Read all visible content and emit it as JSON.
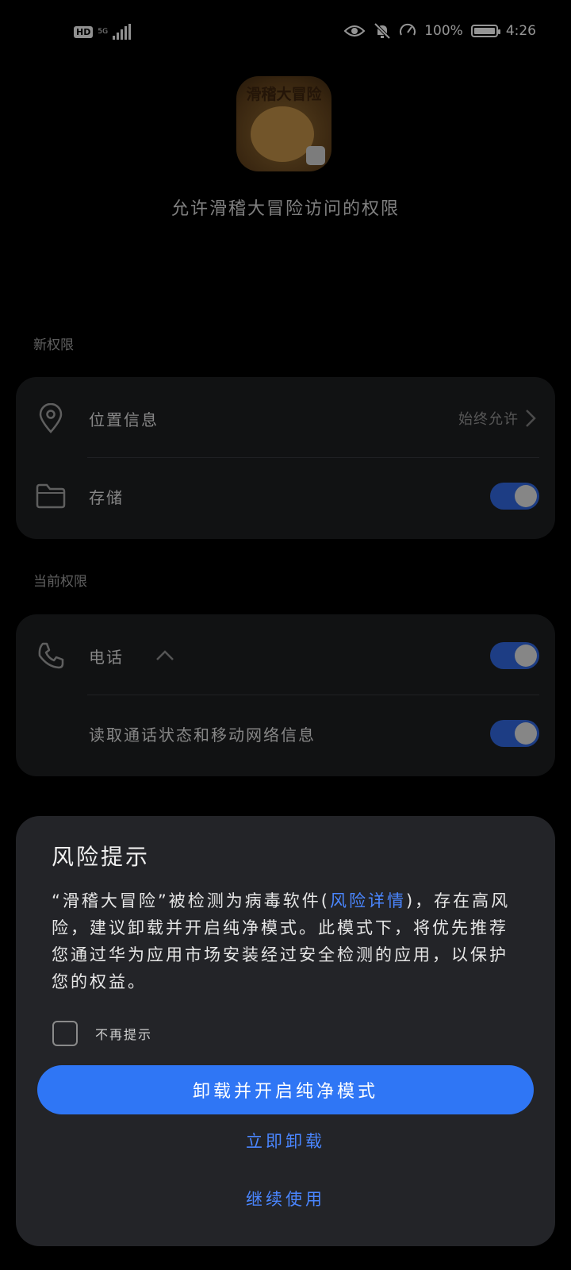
{
  "status_bar": {
    "hd_label": "HD",
    "network_label": "5G",
    "battery_percent": "100%",
    "time": "4:26"
  },
  "header": {
    "app_icon_text": "滑稽大冒险",
    "title": "允许滑稽大冒险访问的权限"
  },
  "new_permissions": {
    "section_label": "新权限",
    "items": [
      {
        "icon": "location-icon",
        "label": "位置信息",
        "value": "始终允许"
      },
      {
        "icon": "folder-icon",
        "label": "存储",
        "toggle_on": true
      }
    ]
  },
  "current_permissions": {
    "section_label": "当前权限",
    "items": [
      {
        "icon": "phone-icon",
        "label": "电话",
        "toggle_on": true
      },
      {
        "label": "读取通话状态和移动网络信息",
        "toggle_on": true
      }
    ]
  },
  "risk_dialog": {
    "title": "风险提示",
    "body_prefix": "“滑稽大冒险”被检测为病毒软件(",
    "body_link": "风险详情",
    "body_suffix": ")，存在高风险，建议卸载并开启纯净模式。此模式下，将优先推荐您通过华为应用市场安装经过安全检测的应用，以保护您的权益。",
    "checkbox_label": "不再提示",
    "primary_button": "卸载并开启纯净模式",
    "uninstall_button": "立即卸载",
    "continue_button": "继续使用",
    "accent_color": "#2f76f5",
    "link_color": "#4a86ff"
  }
}
